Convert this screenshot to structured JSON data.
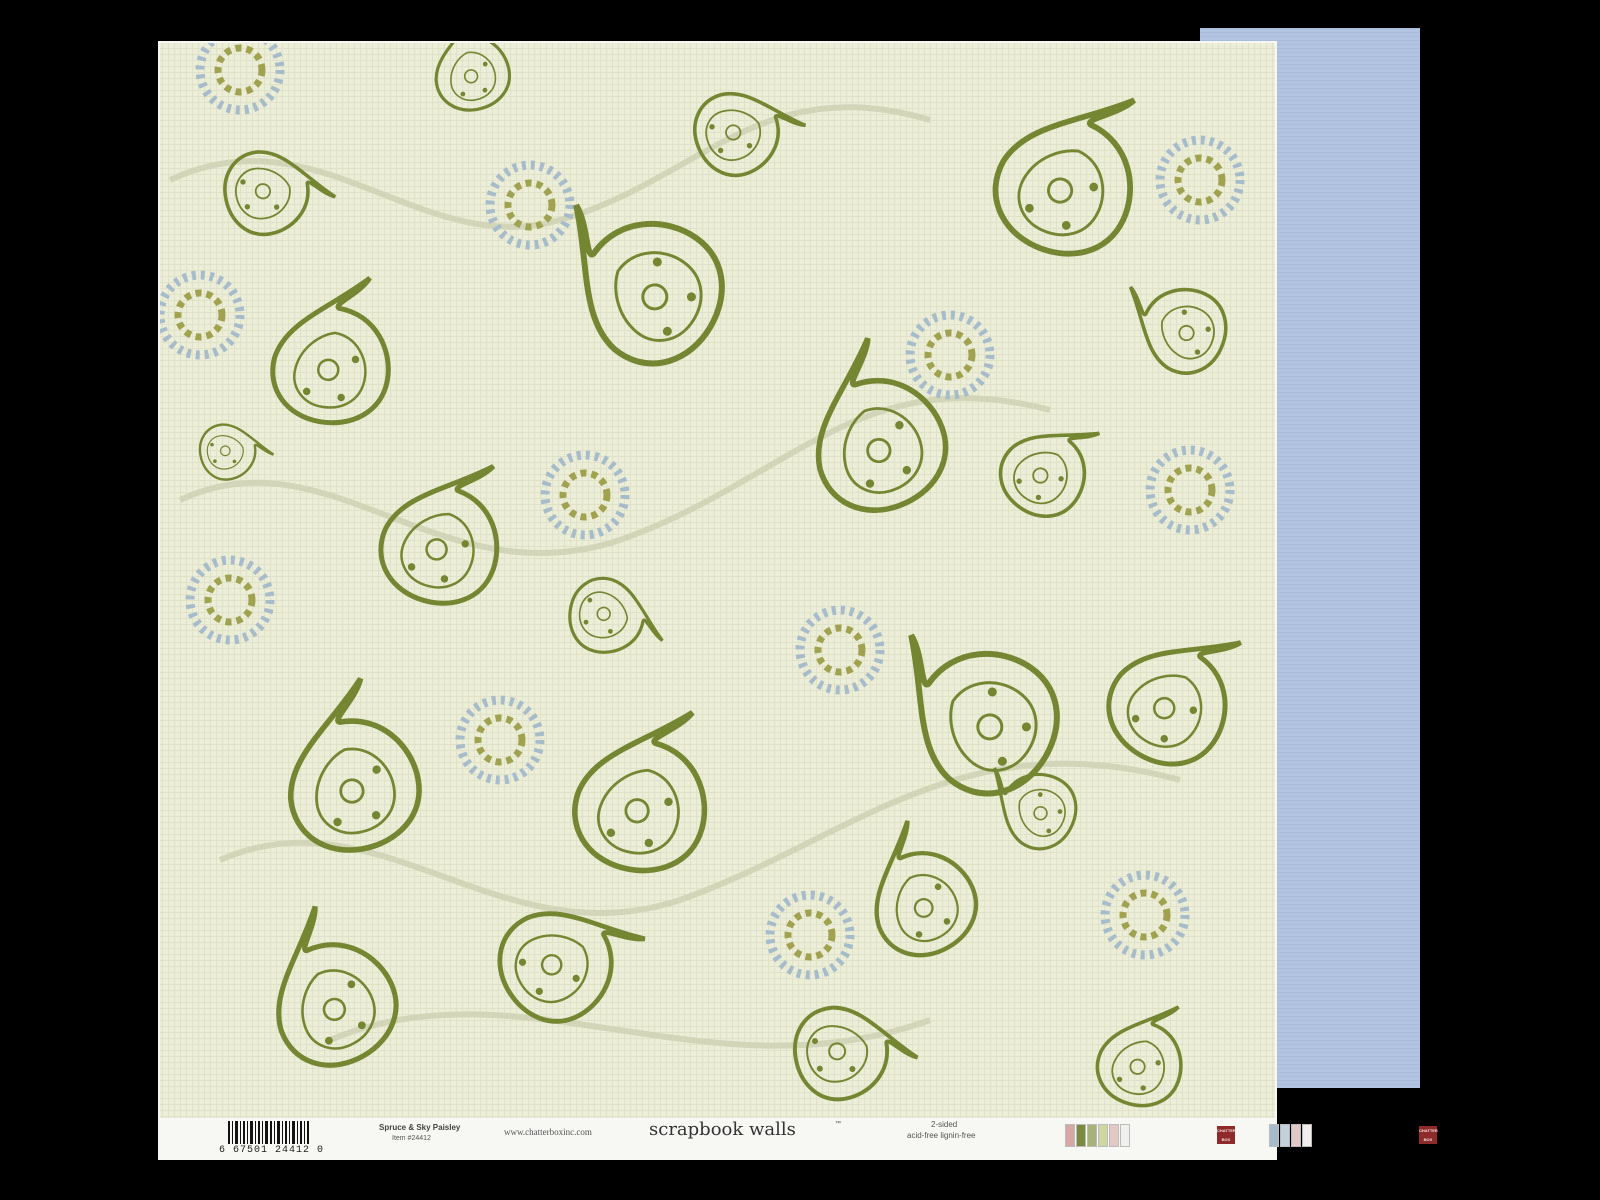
{
  "photo": {
    "subject": "",
    "colors": {
      "background": "#000000",
      "paper": "#eceed7",
      "paisley_green": "#758633",
      "paisley_light": "#c8ccaf",
      "dot_blue": "#a7bccb",
      "reverse_blue": "#b3c4e3",
      "label_strip": "#f7f7f4"
    }
  },
  "label": {
    "barcode_number": "6  67501 24412  0",
    "product_name": "Spruce & Sky Paisley",
    "item_number": "Item #24412",
    "website": "www.chatterboxinc.com",
    "brand": "scrapbook walls",
    "brand_mark": "™",
    "sided": "2-sided",
    "paper_qualities": "acid-free  lignin-free",
    "swatches_left": [
      "#d6a7a3",
      "#7b8a3f",
      "#a7b27b",
      "#cfd6a0",
      "#e3c9c5",
      "#f0f0ee"
    ],
    "swatches_right": [
      "#a7bccb",
      "#c2d1dd",
      "#e4c7c7",
      "#f2f0ee"
    ],
    "logo_text": "CHATTER BOX"
  }
}
